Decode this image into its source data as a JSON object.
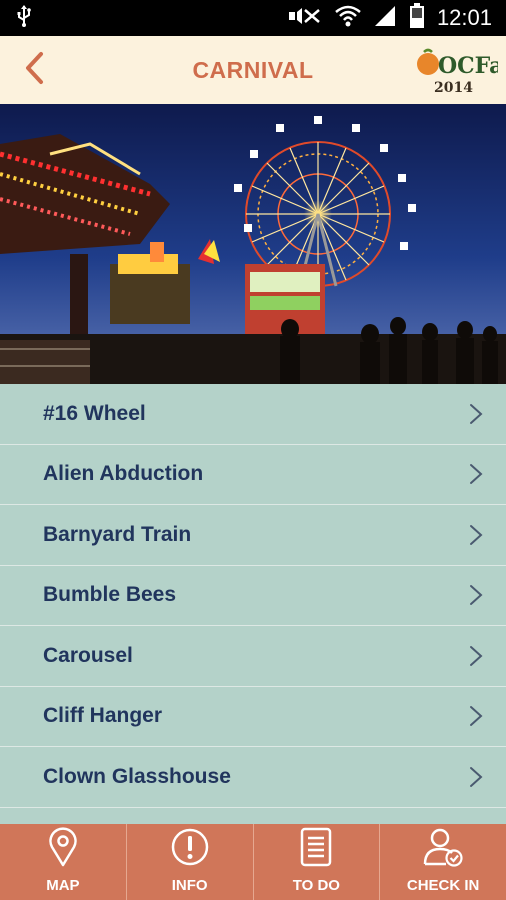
{
  "status_bar": {
    "time": "12:01",
    "icons": [
      "usb-icon",
      "mute-icon",
      "wifi-icon",
      "signal-icon",
      "battery-icon"
    ]
  },
  "header": {
    "title": "CARNIVAL",
    "back_icon": "chevron-left-icon",
    "logo_text": "OCFair",
    "logo_year": "2014",
    "colors": {
      "background": "#fcf2dd",
      "accent": "#cf6d4c"
    }
  },
  "hero": {
    "image": "carnival-night-ferris-wheel-photo"
  },
  "list": {
    "items": [
      {
        "label": "#16 Wheel"
      },
      {
        "label": "Alien Abduction"
      },
      {
        "label": "Barnyard Train"
      },
      {
        "label": "Bumble Bees"
      },
      {
        "label": "Carousel"
      },
      {
        "label": "Cliff Hanger"
      },
      {
        "label": "Clown Glasshouse"
      },
      {
        "label": ""
      }
    ],
    "colors": {
      "row_background": "#b4d2c9",
      "text": "#21355d"
    }
  },
  "tabbar": {
    "tabs": [
      {
        "label": "MAP",
        "icon": "map-pin-icon"
      },
      {
        "label": "INFO",
        "icon": "info-icon"
      },
      {
        "label": "TO DO",
        "icon": "todo-list-icon"
      },
      {
        "label": "CHECK IN",
        "icon": "check-in-user-icon"
      }
    ],
    "colors": {
      "background": "#d07659",
      "text": "#ffffff"
    }
  }
}
